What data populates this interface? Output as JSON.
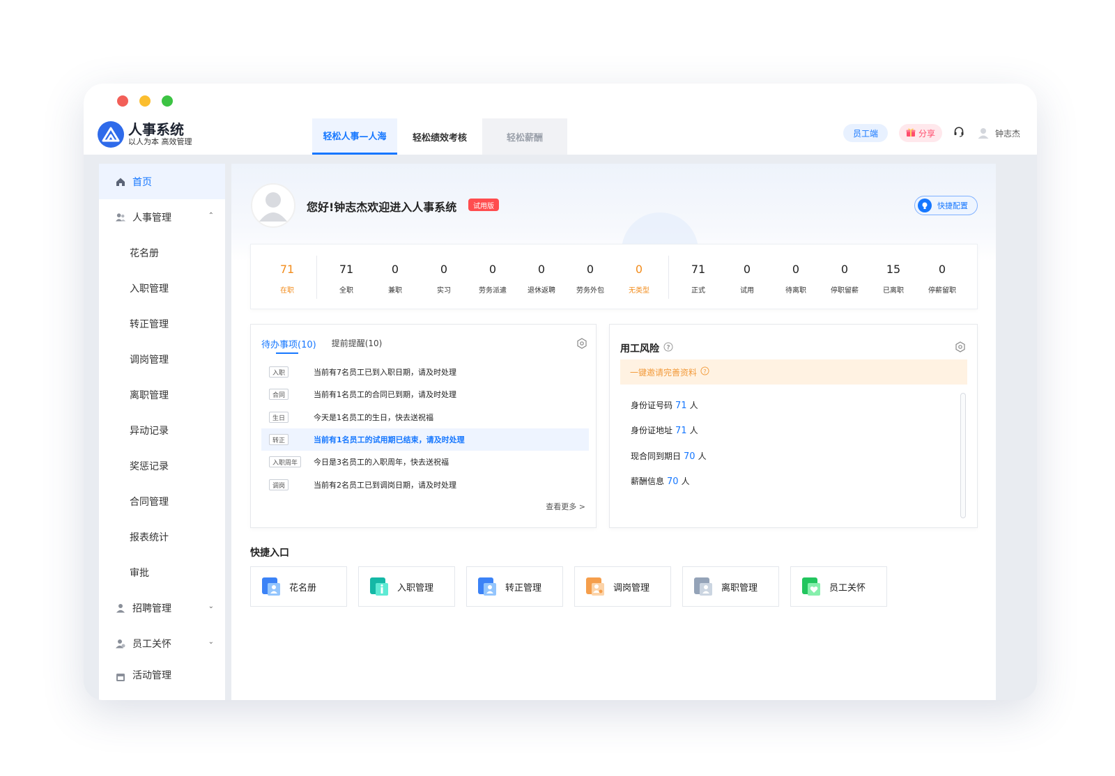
{
  "app": {
    "name": "人事系统",
    "slogan": "以人为本 高效管理"
  },
  "top_tabs": [
    {
      "label": "轻松人事—人海",
      "state": "active"
    },
    {
      "label": "轻松绩效考核",
      "state": "normal"
    },
    {
      "label": "轻松薪酬",
      "state": "disabled"
    }
  ],
  "header": {
    "employee_portal": "员工端",
    "share": "分享",
    "user_name": "钟志杰",
    "icons": [
      "headset-icon",
      "user-icon",
      "gift-icon"
    ]
  },
  "sidebar": {
    "items": [
      {
        "label": "首页",
        "type": "top",
        "icon": "home-icon",
        "active": true
      },
      {
        "label": "人事管理",
        "type": "top",
        "icon": "users-icon",
        "expanded": true
      },
      {
        "label": "花名册",
        "type": "sub"
      },
      {
        "label": "入职管理",
        "type": "sub"
      },
      {
        "label": "转正管理",
        "type": "sub"
      },
      {
        "label": "调岗管理",
        "type": "sub"
      },
      {
        "label": "离职管理",
        "type": "sub"
      },
      {
        "label": "异动记录",
        "type": "sub"
      },
      {
        "label": "奖惩记录",
        "type": "sub"
      },
      {
        "label": "合同管理",
        "type": "sub"
      },
      {
        "label": "报表统计",
        "type": "sub"
      },
      {
        "label": "审批",
        "type": "sub"
      },
      {
        "label": "招聘管理",
        "type": "top",
        "icon": "user-icon",
        "expanded": false
      },
      {
        "label": "员工关怀",
        "type": "top",
        "icon": "care-icon",
        "expanded": false
      },
      {
        "label": "活动管理",
        "type": "top",
        "icon": "calendar-icon"
      }
    ]
  },
  "hero": {
    "greeting": "您好!钟志杰欢迎进入人事系统",
    "trial_badge": "试用版",
    "quick_config": "快捷配置"
  },
  "stats": [
    {
      "value": "71",
      "label": "在职",
      "highlight": true
    },
    {
      "value": "71",
      "label": "全职"
    },
    {
      "value": "0",
      "label": "兼职"
    },
    {
      "value": "0",
      "label": "实习"
    },
    {
      "value": "0",
      "label": "劳务派遣"
    },
    {
      "value": "0",
      "label": "退休返聘"
    },
    {
      "value": "0",
      "label": "劳务外包"
    },
    {
      "value": "0",
      "label": "无类型",
      "highlight": true
    },
    {
      "value": "71",
      "label": "正式"
    },
    {
      "value": "0",
      "label": "试用"
    },
    {
      "value": "0",
      "label": "待离职"
    },
    {
      "value": "0",
      "label": "停职留薪"
    },
    {
      "value": "15",
      "label": "已离职"
    },
    {
      "value": "0",
      "label": "停薪留职"
    }
  ],
  "todo": {
    "tabs": [
      "待办事项(10)",
      "提前提醒(10)"
    ],
    "rows": [
      {
        "tag": "入职",
        "text": "当前有7名员工已到入职日期，请及时处理"
      },
      {
        "tag": "合同",
        "text": "当前有1名员工的合同已到期，请及时处理"
      },
      {
        "tag": "生日",
        "text": "今天是1名员工的生日，快去送祝福"
      },
      {
        "tag": "转正",
        "text": "当前有1名员工的试用期已结束，请及时处理",
        "highlight": true
      },
      {
        "tag": "入职周年",
        "text": "今日是3名员工的入职周年，快去送祝福"
      },
      {
        "tag": "调岗",
        "text": "当前有2名员工已到调岗日期，请及时处理"
      }
    ],
    "more": "查看更多 >"
  },
  "risk": {
    "title": "用工风险",
    "invite": "一键邀请完善资料",
    "items": [
      {
        "label": "身份证号码",
        "value": "71",
        "unit": "人"
      },
      {
        "label": "身份证地址",
        "value": "71",
        "unit": "人"
      },
      {
        "label": "现合同到期日",
        "value": "70",
        "unit": "人"
      },
      {
        "label": "薪酬信息",
        "value": "70",
        "unit": "人"
      }
    ]
  },
  "quick": {
    "title": "快捷入口",
    "items": [
      {
        "label": "花名册",
        "color": "#3b82f6"
      },
      {
        "label": "入职管理",
        "color": "#14b8a6"
      },
      {
        "label": "转正管理",
        "color": "#3b82f6"
      },
      {
        "label": "调岗管理",
        "color": "#f5a05a"
      },
      {
        "label": "离职管理",
        "color": "#94a3b8"
      },
      {
        "label": "员工关怀",
        "color": "#22c55e"
      }
    ]
  }
}
